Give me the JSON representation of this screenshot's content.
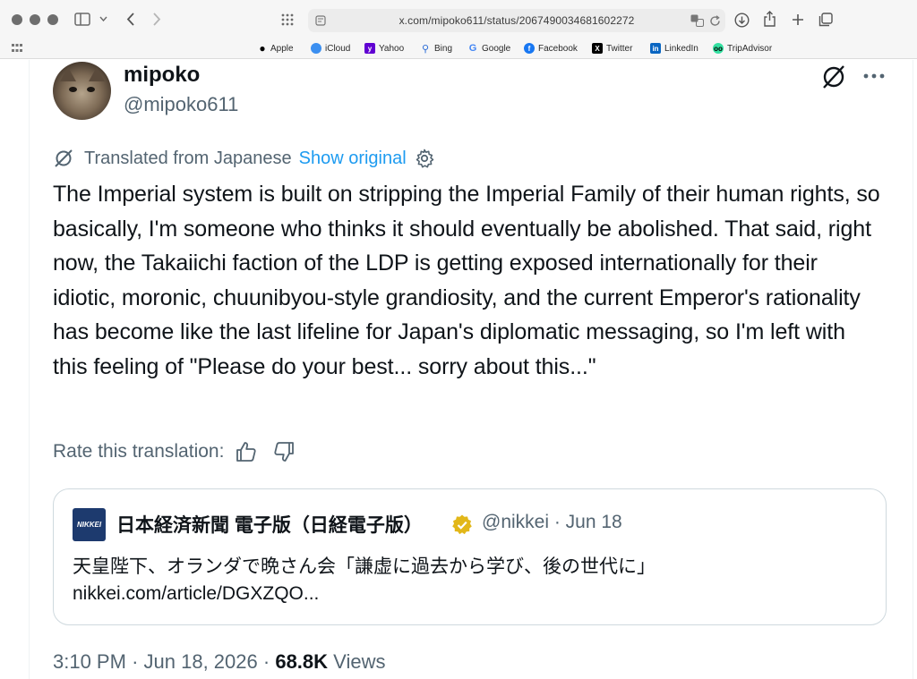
{
  "browser": {
    "url": "x.com/mipoko611/status/2067490034681602272",
    "bookmarks": [
      {
        "label": "Apple",
        "icon": "apple-icon",
        "color": "#000000"
      },
      {
        "label": "iCloud",
        "icon": "cloud-icon",
        "color": "#3b8ff0"
      },
      {
        "label": "Yahoo",
        "icon": "yahoo-icon",
        "color": "#6001d2"
      },
      {
        "label": "Bing",
        "icon": "search-icon",
        "color": "#2b6bd6"
      },
      {
        "label": "Google",
        "icon": "google-icon",
        "color": "#4285f4"
      },
      {
        "label": "Facebook",
        "icon": "facebook-icon",
        "color": "#1877f2"
      },
      {
        "label": "Twitter",
        "icon": "x-icon",
        "color": "#000000"
      },
      {
        "label": "LinkedIn",
        "icon": "linkedin-icon",
        "color": "#0a66c2"
      },
      {
        "label": "TripAdvisor",
        "icon": "tripadvisor-icon",
        "color": "#34e0a1"
      }
    ]
  },
  "tweet": {
    "display_name": "mipoko",
    "handle": "@mipoko611",
    "translated_label": "Translated from Japanese",
    "show_original_label": "Show original",
    "text": "The Imperial system is built on stripping the Imperial Family of their human rights, so basically, I'm someone who thinks it should eventually be abolished. That said, right now, the Takaiichi faction of the LDP is getting exposed internationally for their idiotic, moronic, chuunibyou-style grandiosity, and the current Emperor's rationality has become like the last lifeline for Japan's diplomatic messaging, so I'm left with this feeling of \"Please do your best... sorry about this...\"",
    "rate_label": "Rate this translation:",
    "time": "3:10 PM",
    "date": "Jun 18, 2026",
    "views_count": "68.8K",
    "views_label": "Views",
    "separator": "·"
  },
  "quote": {
    "logo_text": "NIKKEI",
    "name": "日本経済新聞 電子版（日経電子版）",
    "handle_date": "@nikkei · Jun 18",
    "text": "天皇陛下、オランダで晩さん会「謙虚に過去から学び、後の世代に」",
    "link": "nikkei.com/article/DGXZQO..."
  },
  "colors": {
    "accent": "#1d9bf0",
    "secondary_text": "#536471",
    "primary_text": "#0f1419",
    "verified_gold": "#e2b719"
  }
}
